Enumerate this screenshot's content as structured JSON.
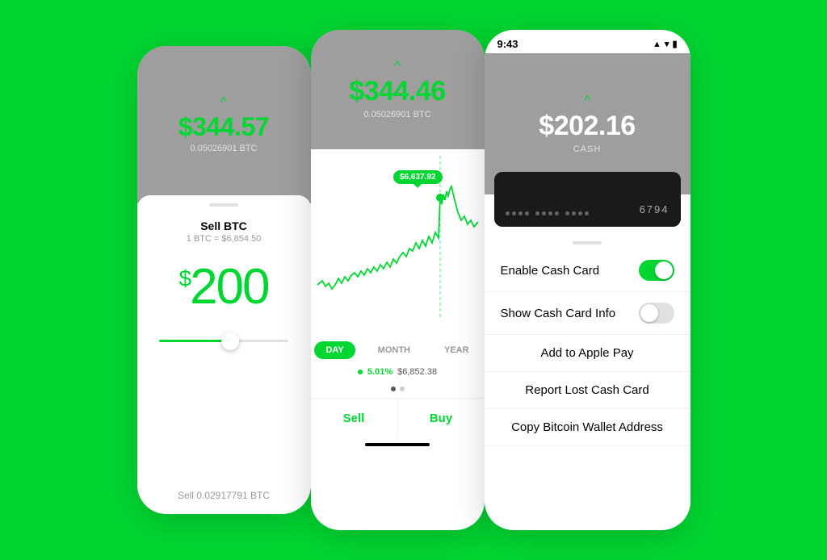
{
  "left_phone": {
    "btc_price": "$344.57",
    "btc_amount": "0.05026901 BTC",
    "sell_title": "Sell BTC",
    "sell_rate": "1 BTC = $6,854.50",
    "sell_amount_dollar": "$",
    "sell_amount_number": "200",
    "sell_btc_label": "Sell 0.02917791 BTC",
    "chevron": "^"
  },
  "middle_phone": {
    "btc_price": "$344.46",
    "btc_amount": "0.05026901 BTC",
    "chevron": "^",
    "chart_tooltip": "$6,637.92",
    "tabs": [
      "DAY",
      "MONTH",
      "YEAR"
    ],
    "active_tab": "DAY",
    "stat_change": "5.01%",
    "stat_price": "$6,852.38",
    "sell_label": "Sell",
    "buy_label": "Buy"
  },
  "right_phone": {
    "status_time": "9:43",
    "status_signal": "▲",
    "status_wifi": "wifi",
    "status_battery": "battery",
    "chevron": "^",
    "balance": "$202.16",
    "balance_sub": "CASH",
    "card_last4": "6794",
    "actions": {
      "enable_cash_card": "Enable Cash Card",
      "enable_toggle": true,
      "show_cash_card_info": "Show Cash Card Info",
      "show_toggle": false,
      "add_apple_pay": "Add to Apple Pay",
      "report_lost": "Report Lost Cash Card",
      "copy_bitcoin": "Copy Bitcoin Wallet Address"
    }
  },
  "colors": {
    "green": "#00d632",
    "gray_bg": "#9e9e9e",
    "dark_card": "#1a1a1a",
    "white": "#ffffff"
  }
}
